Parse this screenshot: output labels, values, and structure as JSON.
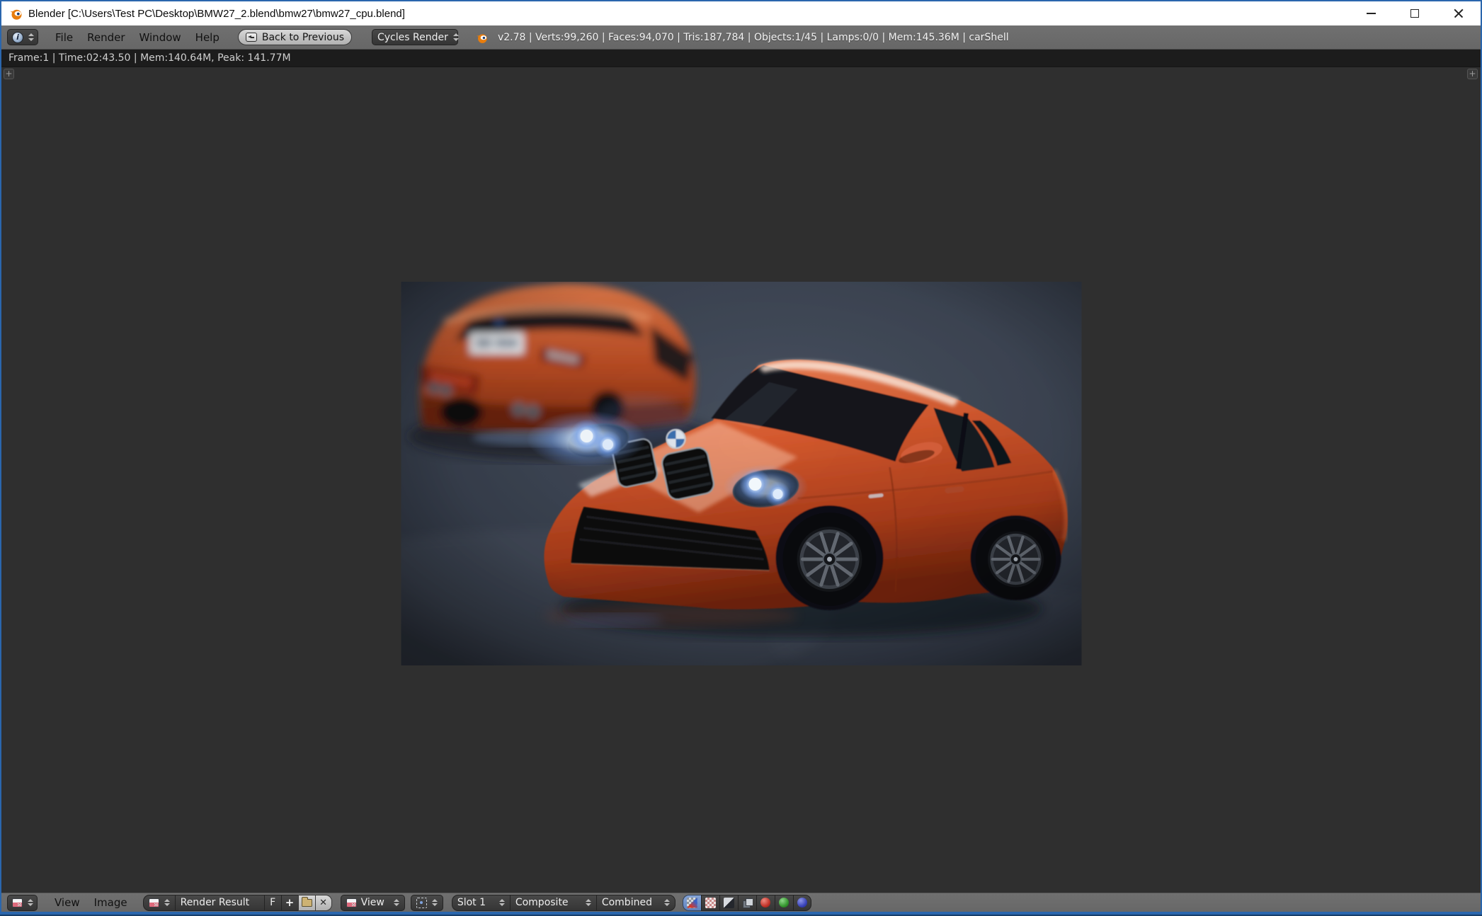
{
  "window": {
    "title": "Blender [C:\\Users\\Test PC\\Desktop\\BMW27_2.blend\\bmw27\\bmw27_cpu.blend]"
  },
  "top_header": {
    "menus": [
      "File",
      "Render",
      "Window",
      "Help"
    ],
    "back_button_label": "Back to Previous",
    "engine": "Cycles Render",
    "stats": "v2.78 | Verts:99,260 | Faces:94,070 | Tris:187,784 | Objects:1/45 | Lamps:0/0 | Mem:145.36M | carShell"
  },
  "render_status": "Frame:1 | Time:02:43.50 | Mem:140.64M, Peak: 141.77M",
  "bottom_header": {
    "menus": [
      "View",
      "Image"
    ],
    "image_name": "Render Result",
    "fake_user_label": "F",
    "mode": "View",
    "slot": "Slot 1",
    "render_layer": "Composite",
    "render_pass": "Combined"
  },
  "icons": {
    "info": "i",
    "plus": "+",
    "unlink": "✕"
  },
  "colors": {
    "window_border": "#2a66ad",
    "titlebar_bg": "#ffffff",
    "header_bg": "#6b6b6b",
    "status_bg": "#1c1c1c",
    "canvas_bg": "#2f2f2f",
    "widget_dark": "#3b3b3b",
    "active_toggle": "#6f94cc",
    "car_paint_orange": "#d65a32",
    "render_backdrop": "#3e4654"
  }
}
